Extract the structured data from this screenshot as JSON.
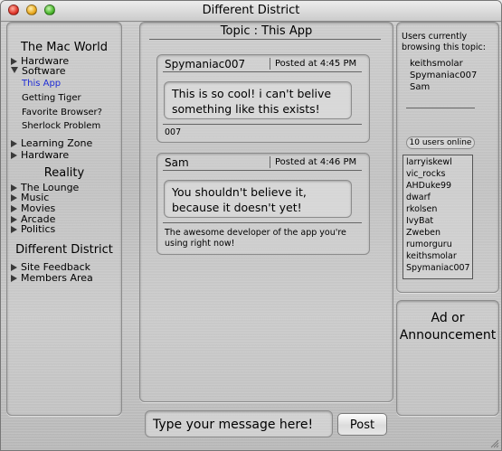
{
  "window": {
    "title": "Different District"
  },
  "sidebar": {
    "section1": "The Mac World",
    "items1": [
      "Hardware",
      "Software"
    ],
    "software_sub": [
      "This App",
      "Getting Tiger",
      "Favorite Browser?",
      "Sherlock Problem"
    ],
    "items1b": [
      "Learning Zone",
      "Hardware"
    ],
    "section2": "Reality",
    "items2": [
      "The Lounge",
      "Music",
      "Movies",
      "Arcade",
      "Politics"
    ],
    "section3": "Different District",
    "items3": [
      "Site Feedback",
      "Members Area"
    ]
  },
  "topic": {
    "title": "Topic : This App"
  },
  "posts": [
    {
      "author": "Spymaniac007",
      "time": "Posted at 4:45 PM",
      "message": "This is so cool! i can't belive something like this exists!",
      "signature": "007"
    },
    {
      "author": "Sam",
      "time": "Posted at 4:46 PM",
      "message": "You shouldn't believe it, because it doesn't yet!",
      "signature": "The awesome developer of the app you're using right now!"
    }
  ],
  "composer": {
    "placeholder": "Type your message here!",
    "post_label": "Post"
  },
  "browsing": {
    "label": "Users currently browsing this topic:",
    "users": [
      "keithsmolar",
      "Spymaniac007",
      "Sam"
    ]
  },
  "online": {
    "label": "10 users online",
    "users": [
      "larryiskewl",
      "vic_rocks",
      "AHDuke99",
      "dwarf",
      "rkolsen",
      "IvyBat",
      "Zweben",
      "rumorguru",
      "keithsmolar",
      "Spymaniac007"
    ]
  },
  "ad": {
    "text": "Ad or Announcement"
  }
}
